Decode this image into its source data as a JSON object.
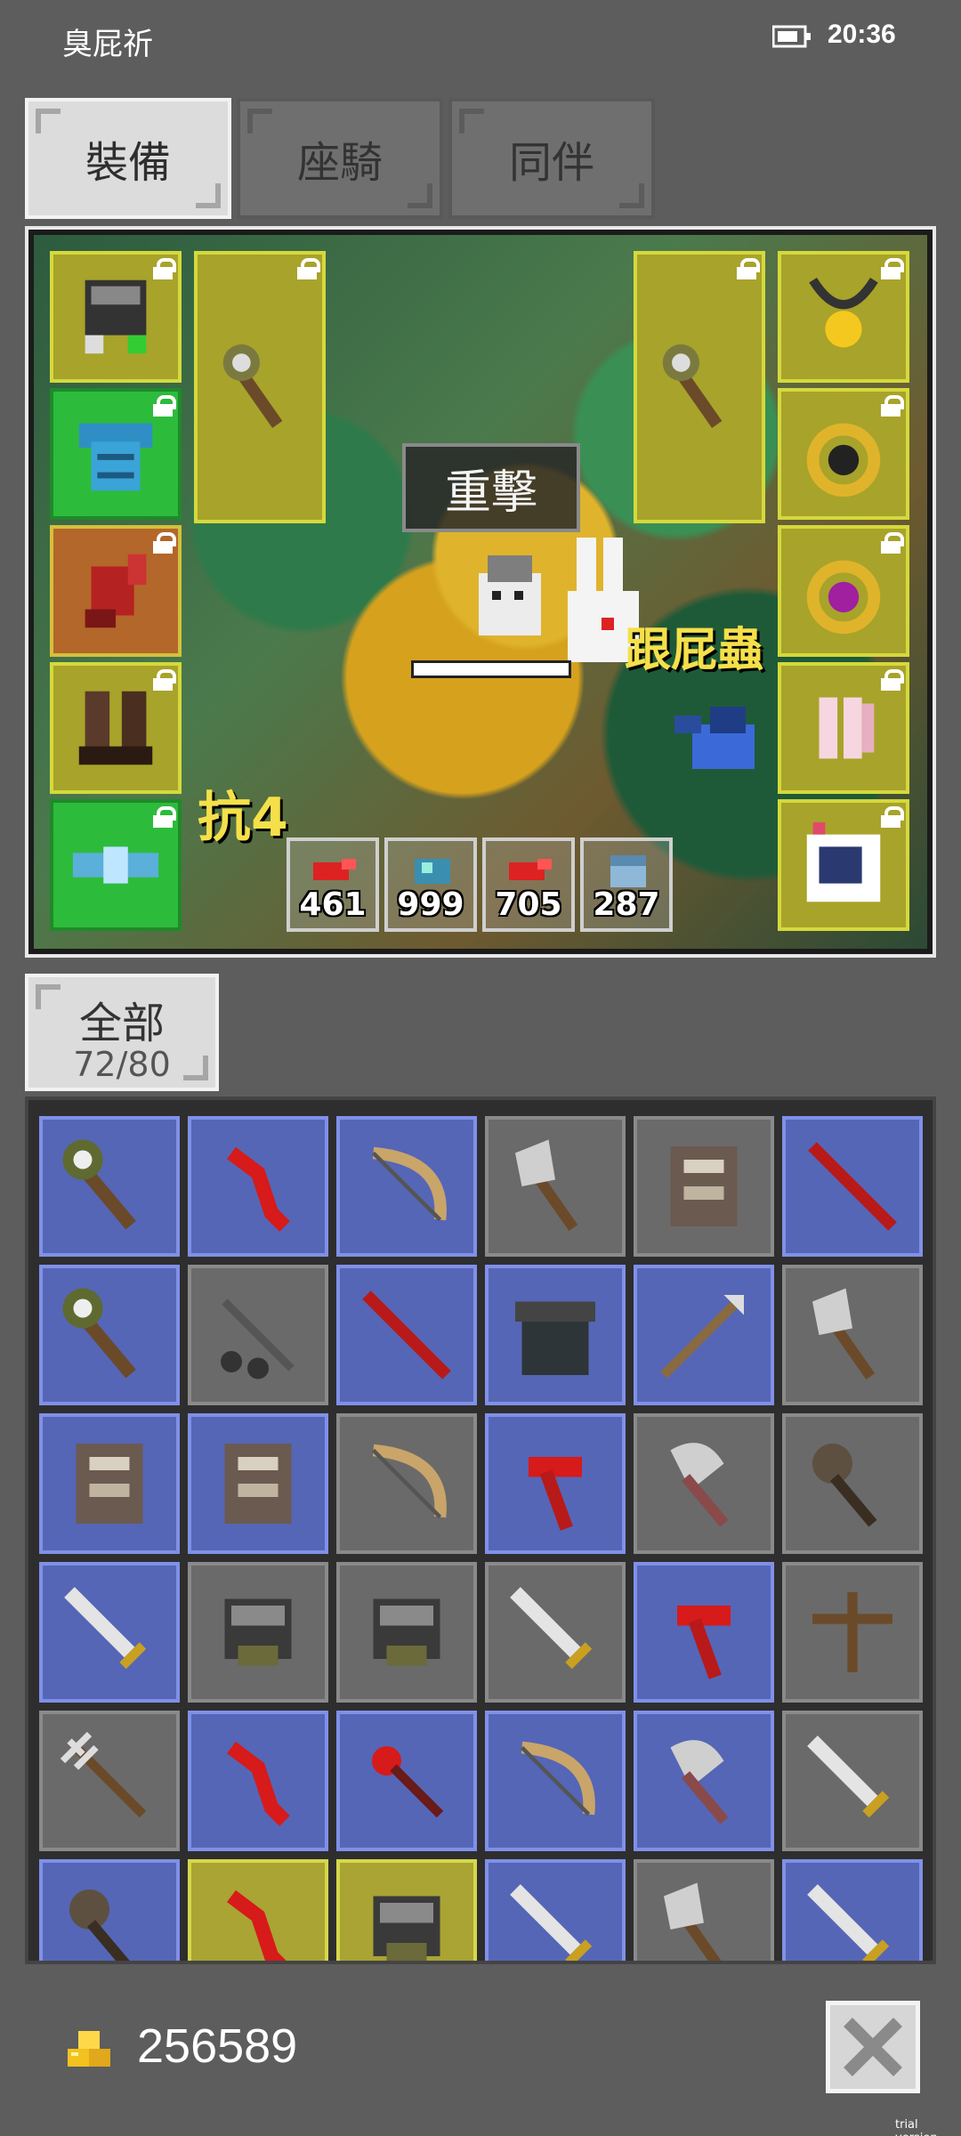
{
  "status_bar": {
    "title": "臭屁祈",
    "time": "20:36"
  },
  "tabs": [
    {
      "label": "裝備",
      "active": true
    },
    {
      "label": "座騎",
      "active": false
    },
    {
      "label": "同伴",
      "active": false
    }
  ],
  "equipment": {
    "skill_label": "重擊",
    "pet_name": "跟屁蟲",
    "resist_text": "抗4",
    "counters": [
      {
        "icon": "red-item-icon",
        "value": "461"
      },
      {
        "icon": "blue-gem-icon",
        "value": "999"
      },
      {
        "icon": "red-item-icon",
        "value": "705"
      },
      {
        "icon": "blue-chest-icon",
        "value": "287"
      }
    ],
    "slots": [
      {
        "name": "helmet-slot",
        "icon": "helmet-icon"
      },
      {
        "name": "armor-slot",
        "icon": "armor-icon"
      },
      {
        "name": "gloves-slot",
        "icon": "gloves-icon"
      },
      {
        "name": "boots-slot",
        "icon": "boots-icon"
      },
      {
        "name": "belt-slot",
        "icon": "belt-icon"
      },
      {
        "name": "main-weapon-slot",
        "icon": "mace-icon"
      },
      {
        "name": "offhand-weapon-slot",
        "icon": "mace-icon"
      },
      {
        "name": "necklace-slot",
        "icon": "necklace-icon"
      },
      {
        "name": "ring-slot-1",
        "icon": "ring-icon"
      },
      {
        "name": "ring-slot-2",
        "icon": "ring-icon"
      },
      {
        "name": "wings-slot",
        "icon": "wings-icon"
      },
      {
        "name": "pet-card-slot",
        "icon": "pet-card-icon"
      }
    ]
  },
  "inventory": {
    "filter_label": "全部",
    "count": "72/80",
    "rows": [
      [
        "blue:mace",
        "blue:red-blade",
        "blue:bow",
        "gray:axe",
        "gray:armor",
        "blue:red-spear"
      ],
      [
        "blue:mace",
        "gray:flail",
        "blue:red-spear",
        "blue:dark-armor",
        "blue:spear",
        "gray:axe"
      ],
      [
        "blue:armor",
        "blue:armor",
        "gray:bow",
        "blue:red-hammer",
        "gray:battle-axe",
        "gray:club"
      ],
      [
        "blue:sword",
        "gray:helmet",
        "gray:helmet",
        "gray:sword",
        "blue:red-hammer",
        "gray:crossbow"
      ],
      [
        "gray:trident",
        "blue:red-blade",
        "blue:red-staff",
        "blue:bow",
        "blue:battle-axe",
        "gray:sword"
      ],
      [
        "blue:club",
        "yellow:red-blade",
        "yellow:helmet",
        "blue:sword",
        "gray:axe",
        "blue:sword"
      ]
    ]
  },
  "footer": {
    "gold": "256589",
    "watermark": "trial version"
  },
  "colors": {
    "rare_blue": "#5566b6",
    "common_gray": "#6a6a6a",
    "epic_yellow": "#a9a433",
    "uncommon_green": "#2dbb3c"
  }
}
